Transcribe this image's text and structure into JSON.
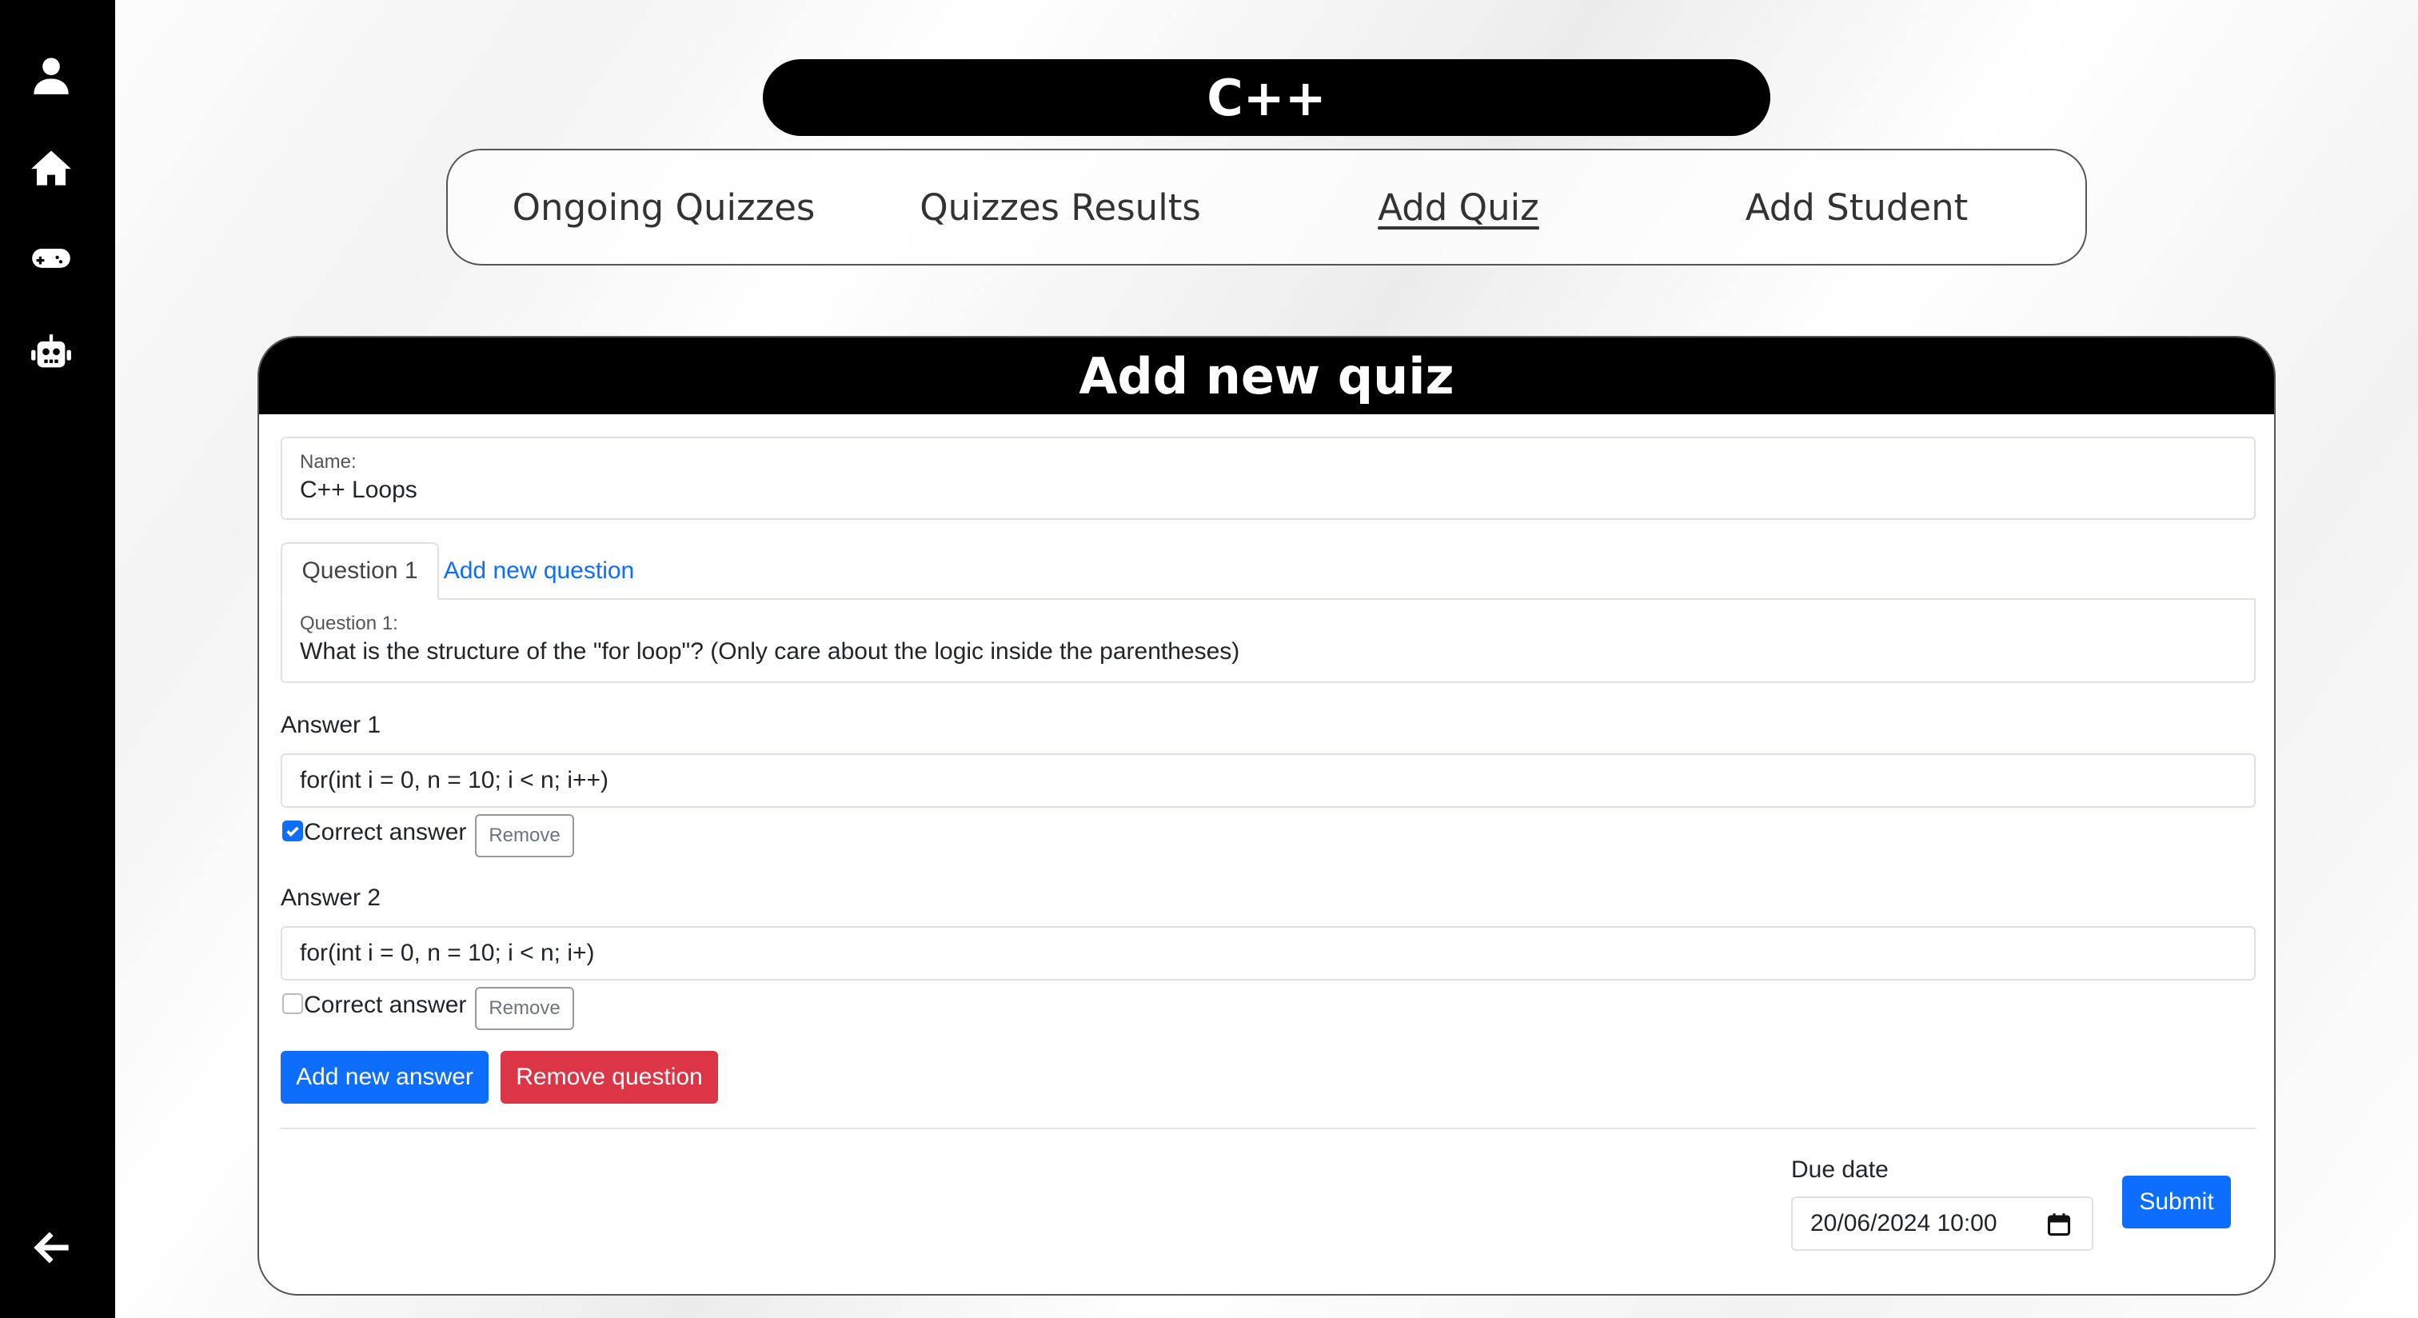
{
  "sidebar": {
    "icons": [
      "user-icon",
      "home-icon",
      "gamepad-icon",
      "robot-icon"
    ],
    "back_icon": "arrow-left-icon"
  },
  "course": {
    "title": "C++"
  },
  "nav": {
    "items": [
      "Ongoing Quizzes",
      "Quizzes Results",
      "Add Quiz",
      "Add Student"
    ],
    "active": "Add Quiz"
  },
  "card": {
    "title": "Add new quiz"
  },
  "form": {
    "name_label": "Name:",
    "name_value": "C++ Loops",
    "tabs": {
      "question1": "Question 1",
      "add_question": "Add new question"
    },
    "question_label": "Question 1:",
    "question_value": "What is the structure of the \"for loop\"? (Only care about the logic inside the parentheses)",
    "answers": [
      {
        "label": "Answer 1",
        "value": "for(int i = 0, n = 10; i < n; i++)",
        "correct": true
      },
      {
        "label": "Answer 2",
        "value": "for(int i = 0, n = 10; i < n; i+)",
        "correct": false
      }
    ],
    "correct_label": "Correct answer",
    "remove_label": "Remove",
    "add_answer_label": "Add new answer",
    "remove_question_label": "Remove question",
    "due_date_label": "Due date",
    "due_date_value": "20/06/2024 10:00",
    "submit_label": "Submit"
  },
  "colors": {
    "primary": "#0d6efd",
    "danger": "#dc3545",
    "dark": "#000000"
  }
}
